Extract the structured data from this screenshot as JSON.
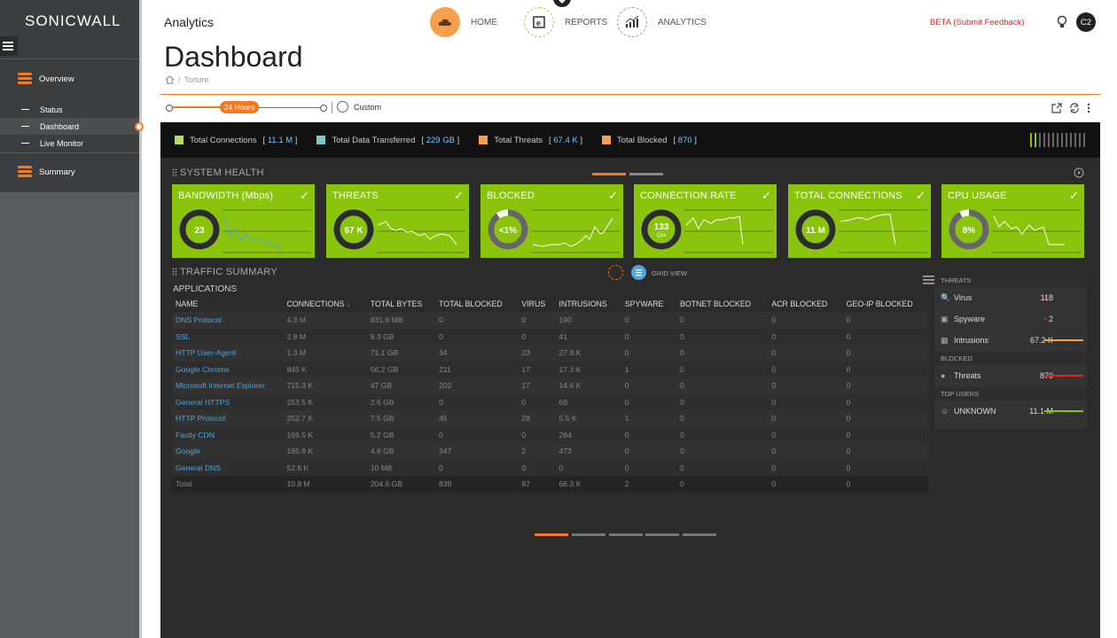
{
  "sidebar": {
    "brand": "SONICWALL",
    "groups": [
      {
        "label": "Overview",
        "icon": "overview-icon"
      },
      {
        "label": "Summary",
        "icon": "summary-icon"
      }
    ],
    "items": [
      {
        "label": "Status"
      },
      {
        "label": "Dashboard",
        "active": true
      },
      {
        "label": "Live Monitor"
      }
    ]
  },
  "header": {
    "section": "Analytics",
    "nav": [
      {
        "label": "HOME",
        "icon": "home-cloud-icon",
        "active": true
      },
      {
        "label": "REPORTS",
        "icon": "reports-icon"
      },
      {
        "label": "ANALYTICS",
        "icon": "analytics-icon"
      }
    ],
    "beta": "BETA (Submit Feedback)",
    "avatar": "C2"
  },
  "page": {
    "title": "Dashboard",
    "breadcrumb": "Torture"
  },
  "timeline": {
    "selected": "24 Hours",
    "custom": "Custom"
  },
  "legend": [
    {
      "label": "Total Connections",
      "value": "11.1 M",
      "color": "#b6dc67"
    },
    {
      "label": "Total Data Transferred",
      "value": "229 GB",
      "color": "#7ec7c9"
    },
    {
      "label": "Total Threats",
      "value": "67.4 K",
      "color": "#f6a04d"
    },
    {
      "label": "Total Blocked",
      "value": "870",
      "color": "#f6a04d"
    }
  ],
  "system_health": {
    "title": "SYSTEM HEALTH",
    "cards": [
      {
        "title": "BANDWIDTH (Mbps)",
        "value": "23",
        "sub": ""
      },
      {
        "title": "THREATS",
        "value": "67 K",
        "sub": ""
      },
      {
        "title": "BLOCKED",
        "value": "<1%",
        "sub": ""
      },
      {
        "title": "CONNECTION RATE",
        "value": "133",
        "sub": "Cps"
      },
      {
        "title": "TOTAL CONNECTIONS",
        "value": "11 M",
        "sub": ""
      },
      {
        "title": "CPU USAGE",
        "value": "8%",
        "sub": ""
      }
    ]
  },
  "traffic": {
    "title": "TRAFFIC SUMMARY",
    "grid_view": "GRID VIEW",
    "subtitle": "APPLICATIONS",
    "columns": [
      "NAME",
      "CONNECTIONS",
      "TOTAL BYTES",
      "TOTAL BLOCKED",
      "VIRUS",
      "INTRUSIONS",
      "SPYWARE",
      "BOTNET BLOCKED",
      "ACR BLOCKED",
      "GEO-IP BLOCKED"
    ],
    "rows": [
      [
        "DNS Protocol",
        "4.3 M",
        "831.6 MB",
        "0",
        "0",
        "190",
        "0",
        "0",
        "0",
        "0"
      ],
      [
        "SSL",
        "2.8 M",
        "9.3 GB",
        "0",
        "0",
        "41",
        "0",
        "0",
        "0",
        "0"
      ],
      [
        "HTTP User-Agent",
        "1.3 M",
        "71.1 GB",
        "34",
        "23",
        "27.8 K",
        "0",
        "0",
        "0",
        "0"
      ],
      [
        "Google Chrome",
        "845 K",
        "56.2 GB",
        "211",
        "17",
        "17.3 K",
        "1",
        "0",
        "0",
        "0"
      ],
      [
        "Microsoft Internet Explorer",
        "715.3 K",
        "47 GB",
        "202",
        "17",
        "14.6 K",
        "0",
        "0",
        "0",
        "0"
      ],
      [
        "General HTTPS",
        "253.5 K",
        "2.6 GB",
        "0",
        "0",
        "69",
        "0",
        "0",
        "0",
        "0"
      ],
      [
        "HTTP Protocol",
        "252.7 K",
        "7.5 GB",
        "45",
        "28",
        "5.5 K",
        "1",
        "0",
        "0",
        "0"
      ],
      [
        "Fastly CDN",
        "169.5 K",
        "5.2 GB",
        "0",
        "0",
        "284",
        "0",
        "0",
        "0",
        "0"
      ],
      [
        "Google",
        "165.8 K",
        "4.8 GB",
        "347",
        "2",
        "473",
        "0",
        "0",
        "0",
        "0"
      ],
      [
        "General DNS",
        "52.6 K",
        "10 MB",
        "0",
        "0",
        "0",
        "0",
        "0",
        "0",
        "0"
      ]
    ],
    "total": [
      "Total",
      "10.8 M",
      "204.6 GB",
      "839",
      "87",
      "66.3 K",
      "2",
      "0",
      "0",
      "0"
    ]
  },
  "right_panel": {
    "threats_header": "THREATS",
    "threats": [
      {
        "label": "Virus",
        "value": "118",
        "icon": "virus-icon"
      },
      {
        "label": "Spyware",
        "value": "2",
        "icon": "spyware-icon"
      },
      {
        "label": "Intrusions",
        "value": "67.2 K",
        "icon": "intrusions-icon",
        "bar": "#f6a04d"
      }
    ],
    "blocked_header": "BLOCKED",
    "blocked": [
      {
        "label": "Threats",
        "value": "870",
        "icon": "info-icon",
        "bar": "#d9262b"
      }
    ],
    "users_header": "TOP USERS",
    "users": [
      {
        "label": "UNKNOWN",
        "value": "11.1 M",
        "icon": "user-icon",
        "bar": "#8ac40c"
      }
    ]
  }
}
